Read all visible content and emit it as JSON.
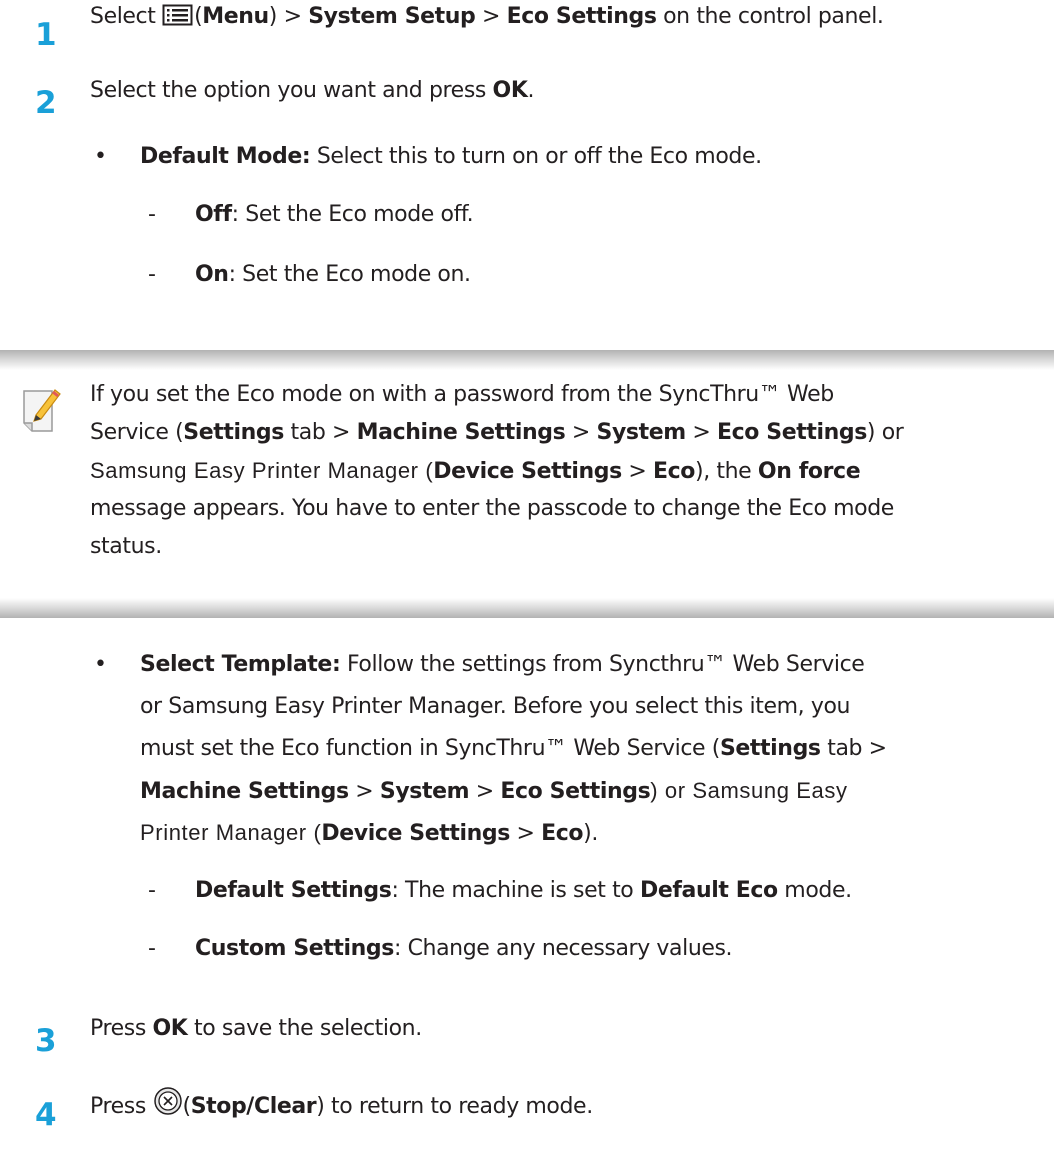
{
  "steps": {
    "s1": {
      "num": "1",
      "select": "Select ",
      "menu_open": "(",
      "menu": "Menu",
      "menu_close": ") > ",
      "system_setup": "System Setup",
      "sep": " > ",
      "eco_settings": "Eco Settings",
      "tail": " on the control panel."
    },
    "s2": {
      "num": "2",
      "text": "Select the option you want and press ",
      "ok": "OK",
      "period": "."
    },
    "s3": {
      "num": "3",
      "press": "Press ",
      "ok": "OK",
      "tail": " to save the selection."
    },
    "s4": {
      "num": "4",
      "press": "Press ",
      "open": "(",
      "stop": "Stop/Clear",
      "tail": ") to return to ready mode."
    }
  },
  "default_mode": {
    "bullet": "•",
    "label": "Default Mode:",
    "text": " Select this to turn on or off the Eco mode.",
    "off_label": "Off",
    "off_text": ": Set the Eco mode off.",
    "on_label": "On",
    "on_text": ": Set the Eco mode on.",
    "dash": "-"
  },
  "note": {
    "l1": "If you set the Eco mode on with a password from the SyncThru™ Web",
    "l2a": "Service (",
    "settings": "Settings",
    "l2b": " tab > ",
    "machine_settings": "Machine Settings",
    "gt": " > ",
    "system": "System",
    "eco_settings": "Eco Settings",
    "l2c": ") or",
    "l3a": "Samsung Easy Printer Manager (",
    "device_settings": "Device Settings",
    "eco": "Eco",
    "l3b": "), the ",
    "on_force": "On force",
    "l4": "message appears. You have to enter the passcode to change the Eco mode",
    "l5": "status."
  },
  "select_template": {
    "bullet": "•",
    "label": "Select Template:",
    "l1": " Follow the settings from Syncthru™ Web Service",
    "l2": "or Samsung Easy Printer Manager. Before you select this item, you",
    "l3a": "must set the Eco function in SyncThru™ Web Service (",
    "settings": "Settings",
    "l3b": " tab >",
    "machine_settings": "Machine Settings",
    "gt": " > ",
    "system": "System",
    "eco_settings": "Eco Settings",
    "l4b": ") or Samsung Easy",
    "l5a": "Printer Manager (",
    "device_settings": "Device Settings",
    "eco": "Eco",
    "l5b": ").",
    "dash": "-",
    "default_label": "Default Settings",
    "default_text_a": ": The machine is set to ",
    "default_eco": "Default Eco",
    "default_text_b": " mode.",
    "custom_label": "Custom Settings",
    "custom_text": ": Change any necessary values."
  },
  "icons": {
    "menu": "menu-icon",
    "stop": "stop-clear-icon",
    "note": "note-pencil-icon"
  },
  "colors": {
    "step_number": "#1aa0d8",
    "text": "#231f20",
    "note_band": "#b2b2b2"
  }
}
